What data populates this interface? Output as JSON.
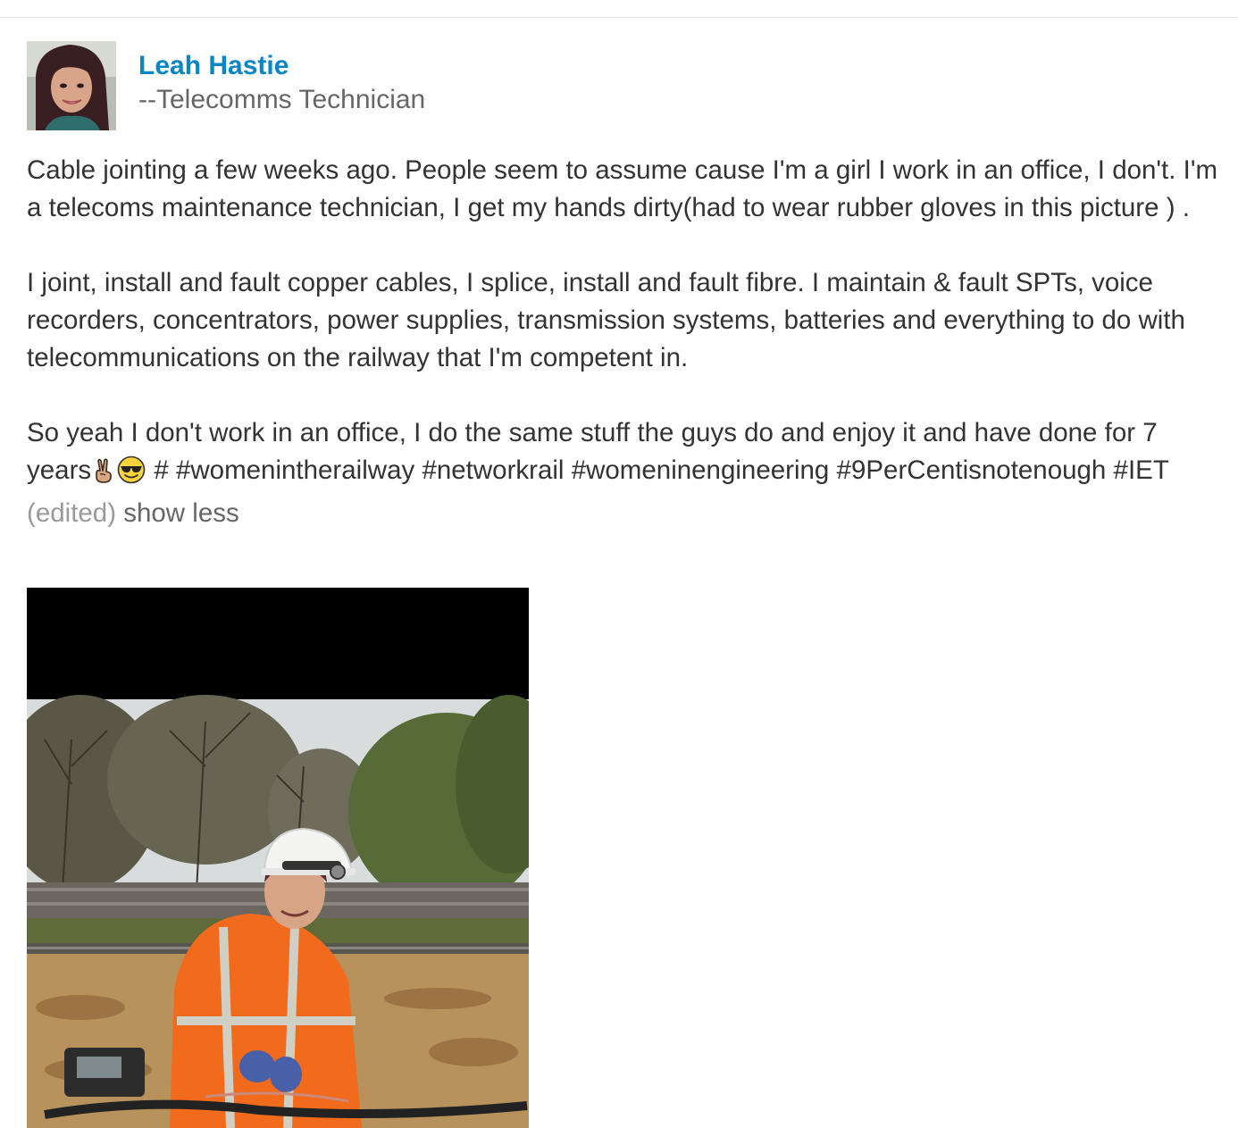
{
  "author": {
    "name": "Leah Hastie",
    "title": "--Telecomms Technician",
    "avatar_icon": "profile-photo"
  },
  "post": {
    "paragraph1": "Cable jointing a few weeks ago. People seem to assume cause I'm a girl I work in an office, I don't. I'm a telecoms maintenance technician, I get my hands dirty(had to wear rubber gloves in this picture ) .",
    "paragraph2": "I joint, install and fault copper cables, I splice, install and fault fibre. I maintain & fault SPTs, voice recorders, concentrators, power supplies, transmission systems, batteries and everything to do with telecommunications on the railway that I'm competent in.",
    "paragraph3_text": "So yeah I don't work in an office, I do the same stuff the guys do and enjoy it and have done for 7 years",
    "emoji": [
      "victory-hand-icon",
      "sunglasses-face-icon"
    ],
    "hash_sep": " # ",
    "hashtags": [
      "#womenintherailway",
      "#networkrail",
      "#womeninengineering",
      "#9PerCentisnotenough",
      "#IET"
    ],
    "edited_label": "(edited)",
    "show_less_label": "show less"
  },
  "photo": {
    "subject": "technician in orange hi-vis and white hard hat at railway trackside"
  },
  "colors": {
    "link": "#0a86c4",
    "text": "#333333",
    "muted": "#666666",
    "edited": "#999999",
    "hi_vis": "#f26a1b"
  }
}
